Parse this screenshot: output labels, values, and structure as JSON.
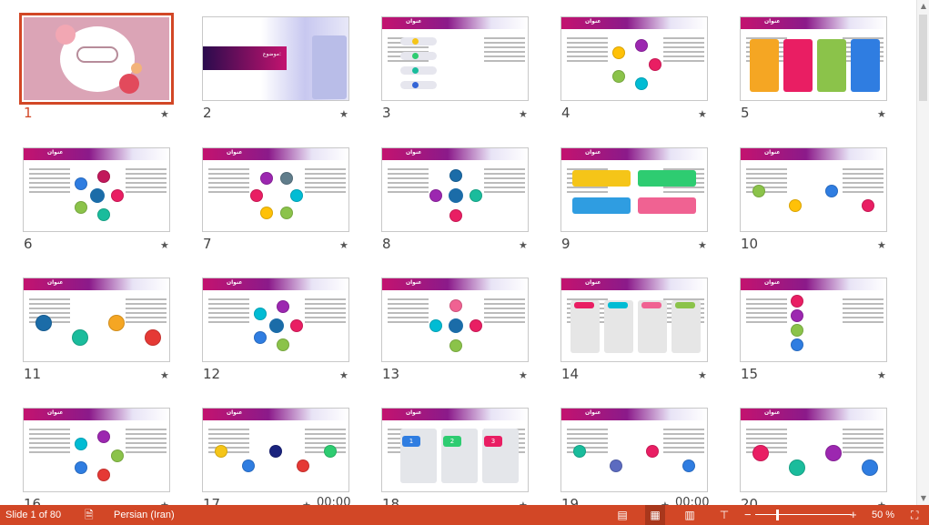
{
  "slide_title": "عنوان",
  "slides": [
    {
      "n": "1",
      "kind": "cover",
      "selected": true
    },
    {
      "n": "2",
      "kind": "subject",
      "label": "موضوع:"
    },
    {
      "n": "3",
      "kind": "list",
      "colors": [
        "#f5c518",
        "#2ecc71",
        "#1abc9c",
        "#3465d6"
      ]
    },
    {
      "n": "4",
      "kind": "flower",
      "colors": [
        "#e91e63",
        "#00bcd4",
        "#8bc34a",
        "#ffc107",
        "#9c27b0"
      ]
    },
    {
      "n": "5",
      "kind": "columns",
      "colors": [
        "#f5a623",
        "#e91e63",
        "#8bc34a",
        "#2f7de1"
      ]
    },
    {
      "n": "6",
      "kind": "hub",
      "colors": [
        "#e91e63",
        "#1abc9c",
        "#8bc34a",
        "#2f7de1",
        "#c2185b"
      ]
    },
    {
      "n": "7",
      "kind": "pinwheel",
      "colors": [
        "#00bcd4",
        "#8bc34a",
        "#ffc107",
        "#e91e63",
        "#9c27b0",
        "#607d8b"
      ]
    },
    {
      "n": "8",
      "kind": "knot",
      "colors": [
        "#1abc9c",
        "#e91e63",
        "#9c27b0",
        "#1b6ca8"
      ]
    },
    {
      "n": "9",
      "kind": "numbers",
      "colors": [
        "#f5c518",
        "#2ecc71",
        "#2f9de1",
        "#f06292"
      ]
    },
    {
      "n": "10",
      "kind": "waves",
      "colors": [
        "#8bc34a",
        "#ffc107",
        "#2f7de1",
        "#e91e63"
      ]
    },
    {
      "n": "11",
      "kind": "balls",
      "colors": [
        "#1b6ca8",
        "#1abc9c",
        "#f5a623",
        "#e53935"
      ]
    },
    {
      "n": "12",
      "kind": "spiral",
      "colors": [
        "#e91e63",
        "#8bc34a",
        "#2f7de1",
        "#00bcd4",
        "#9c27b0"
      ]
    },
    {
      "n": "13",
      "kind": "hub",
      "colors": [
        "#e91e63",
        "#8bc34a",
        "#00bcd4",
        "#f06292"
      ]
    },
    {
      "n": "14",
      "kind": "cards",
      "colors": [
        "#e91e63",
        "#00bcd4",
        "#f06292",
        "#8bc34a"
      ]
    },
    {
      "n": "15",
      "kind": "chain",
      "colors": [
        "#e91e63",
        "#9c27b0",
        "#8bc34a",
        "#2f7de1"
      ]
    },
    {
      "n": "16",
      "kind": "flower",
      "colors": [
        "#8bc34a",
        "#e53935",
        "#2f7de1",
        "#00bcd4",
        "#9c27b0"
      ]
    },
    {
      "n": "17",
      "kind": "snake",
      "colors": [
        "#f5c518",
        "#2f7de1",
        "#1a237e",
        "#e53935",
        "#2ecc71"
      ],
      "timing": "00:00"
    },
    {
      "n": "18",
      "kind": "arrows",
      "colors": [
        "#2f7de1",
        "#2ecc71",
        "#e91e63"
      ],
      "labels": [
        "1",
        "2",
        "3"
      ]
    },
    {
      "n": "19",
      "kind": "snake",
      "colors": [
        "#1abc9c",
        "#5c6bc0",
        "#e91e63",
        "#2f7de1"
      ],
      "timing": "00:00"
    },
    {
      "n": "20",
      "kind": "balls",
      "colors": [
        "#e91e63",
        "#1abc9c",
        "#9c27b0",
        "#2f7de1"
      ]
    }
  ],
  "status": {
    "slide_info": "Slide 1 of 80",
    "language": "Persian (Iran)",
    "zoom": "50 %",
    "zoom_percent": 50
  },
  "colors": {
    "accent": "#d24726"
  }
}
